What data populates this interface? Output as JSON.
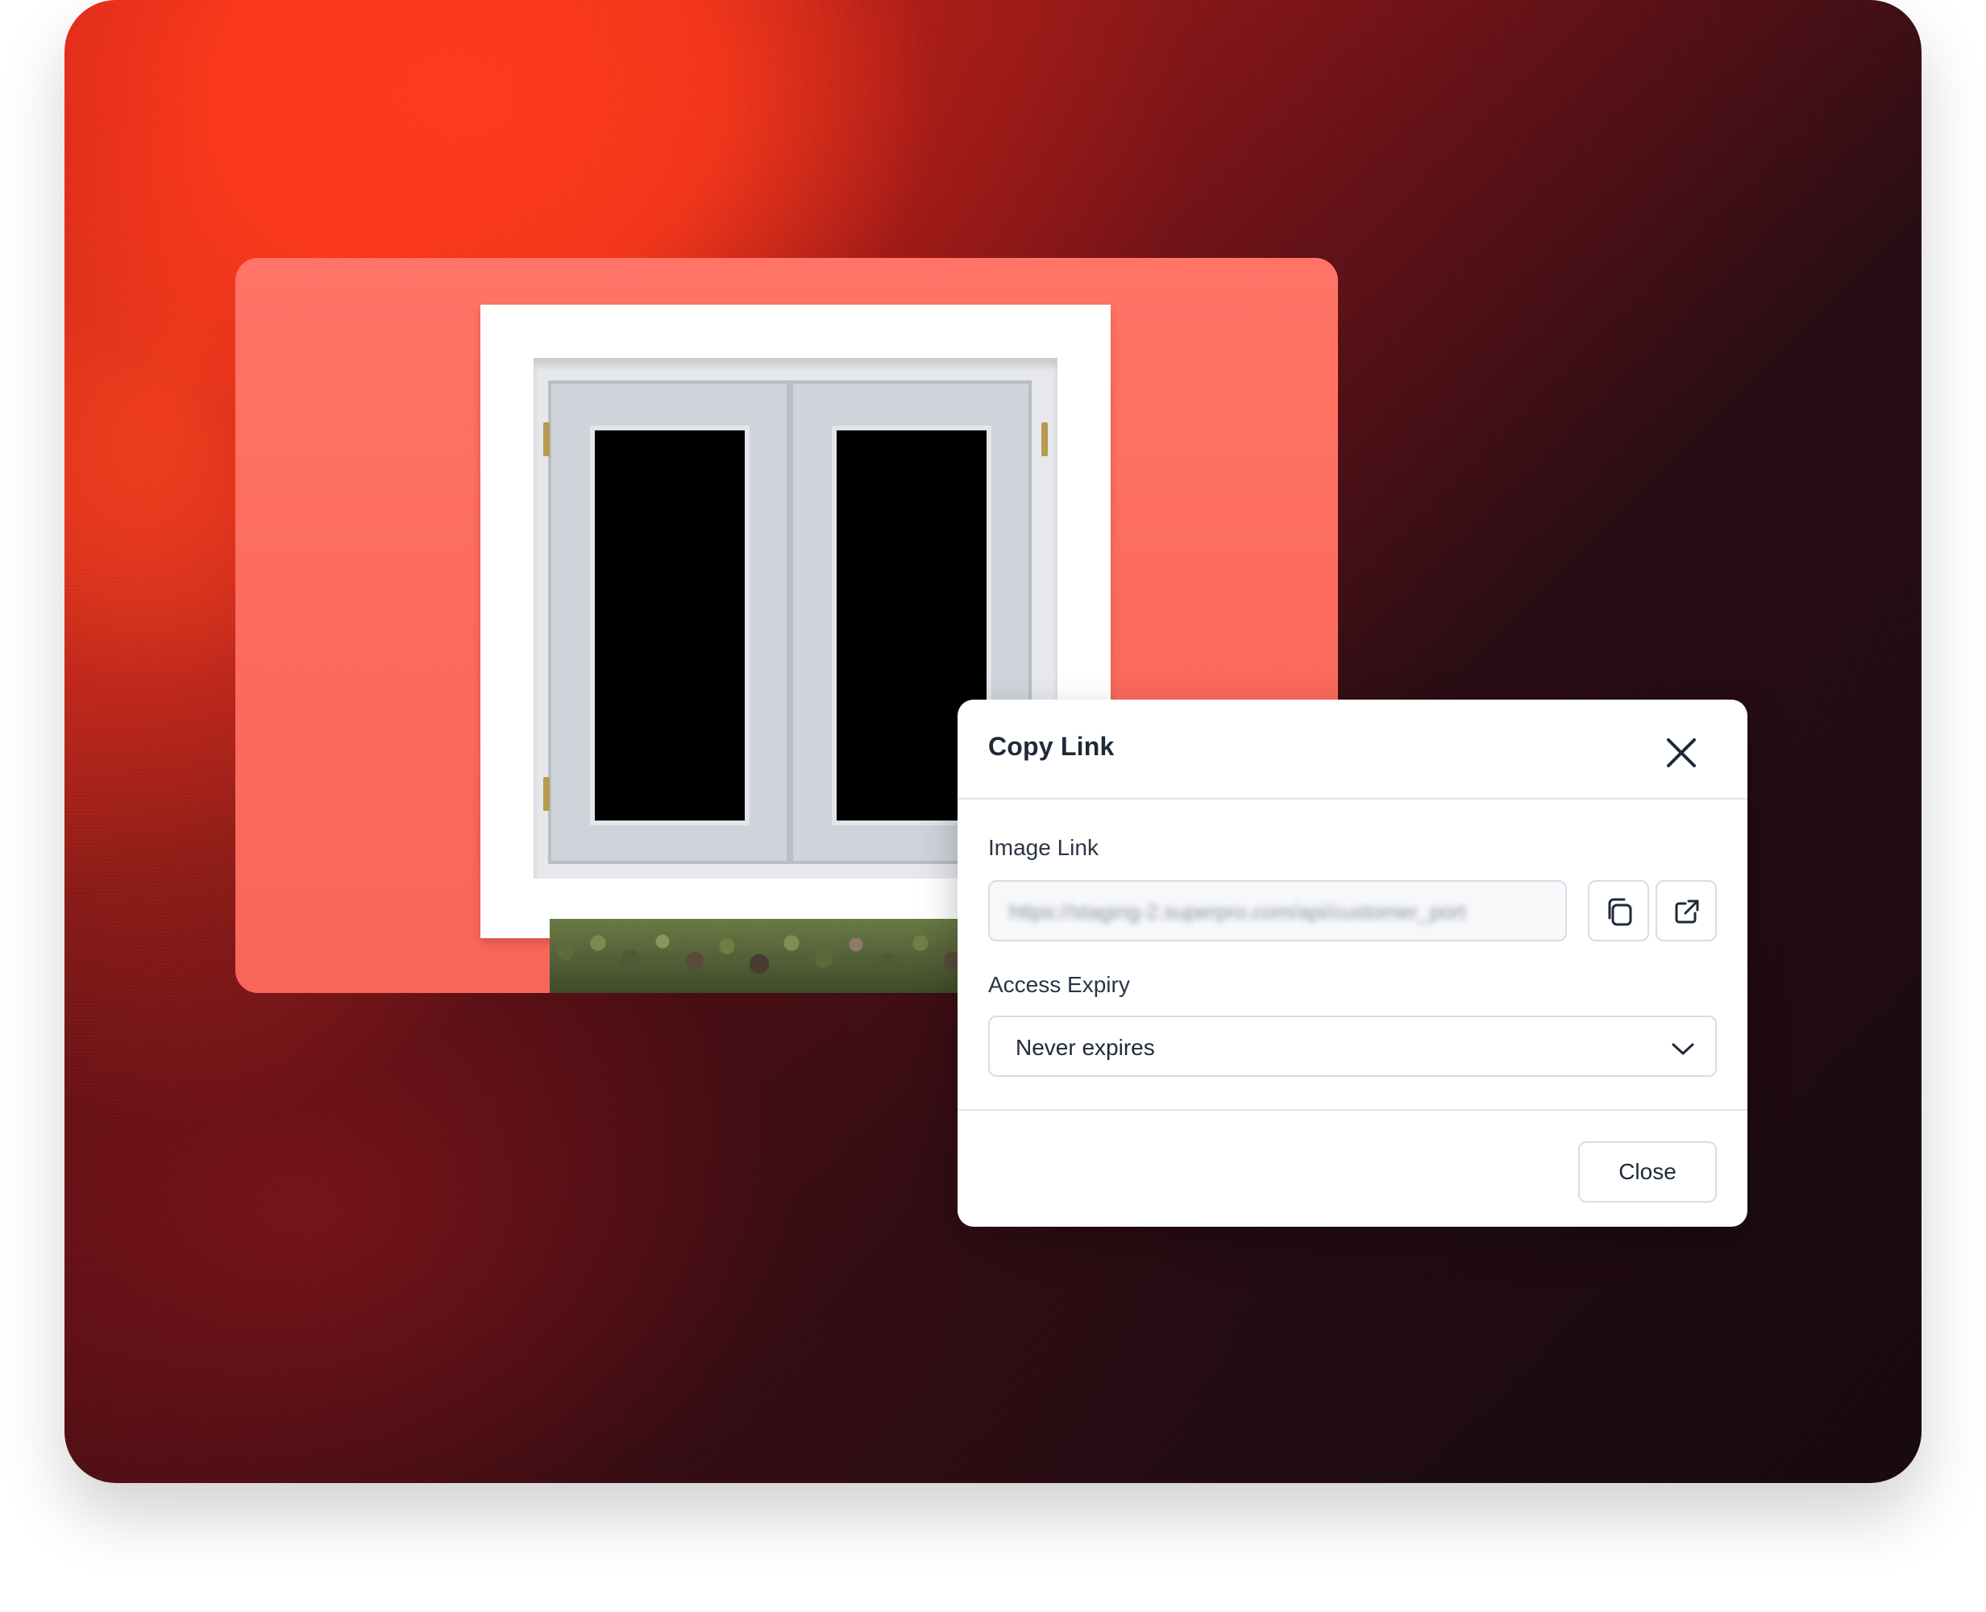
{
  "dialog": {
    "title": "Copy Link",
    "image_link": {
      "label": "Image Link",
      "value": "https://staging-2.superpro.com/api/customer_port"
    },
    "access_expiry": {
      "label": "Access Expiry",
      "selected": "Never expires"
    },
    "close_label": "Close"
  },
  "icons": {
    "close": "close-icon",
    "copy": "copy-icon",
    "open_external": "external-link-icon",
    "dropdown": "chevron-down-icon"
  },
  "colors": {
    "background_accent": "#ff3a1c",
    "background_dark": "#170a10",
    "photo_wall": "#fb6a5c",
    "text_primary": "#1f2937",
    "border": "#d9dde3"
  }
}
